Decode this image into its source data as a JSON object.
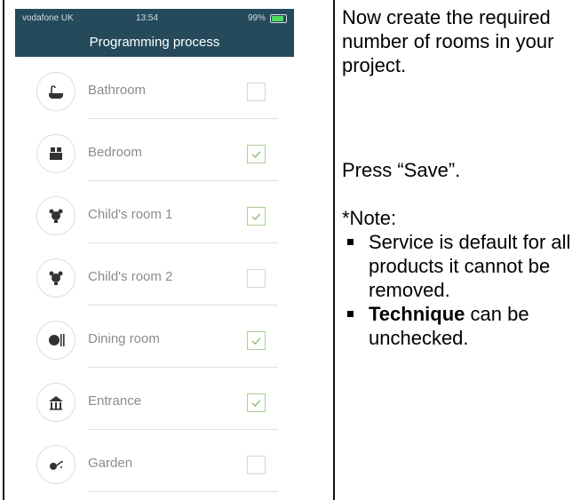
{
  "status": {
    "carrier": "vodafone UK",
    "time": "13:54",
    "battery": "99%"
  },
  "header": {
    "title": "Programming process"
  },
  "rooms": [
    {
      "label": "Bathroom",
      "icon": "bathtub-icon",
      "checked": false
    },
    {
      "label": "Bedroom",
      "icon": "bed-icon",
      "checked": true
    },
    {
      "label": "Child's room 1",
      "icon": "teddy-bear-icon",
      "checked": true
    },
    {
      "label": "Child's room 2",
      "icon": "teddy-bear-icon",
      "checked": false
    },
    {
      "label": "Dining room",
      "icon": "plate-cutlery-icon",
      "checked": true
    },
    {
      "label": "Entrance",
      "icon": "house-entrance-icon",
      "checked": true
    },
    {
      "label": "Garden",
      "icon": "watering-can-icon",
      "checked": false
    }
  ],
  "instructions": {
    "line1": "Now create the required number of rooms in your project.",
    "line2": "Press “Save”.",
    "note": "*Note:",
    "bullets": [
      {
        "text": "Service is default for all products it cannot be removed."
      },
      {
        "bold": "Technique",
        "text": " can be unchecked."
      }
    ]
  },
  "colors": {
    "nav_bg": "#244a5c",
    "check_green": "#7db86a",
    "label_gray": "#8c8c8c"
  }
}
